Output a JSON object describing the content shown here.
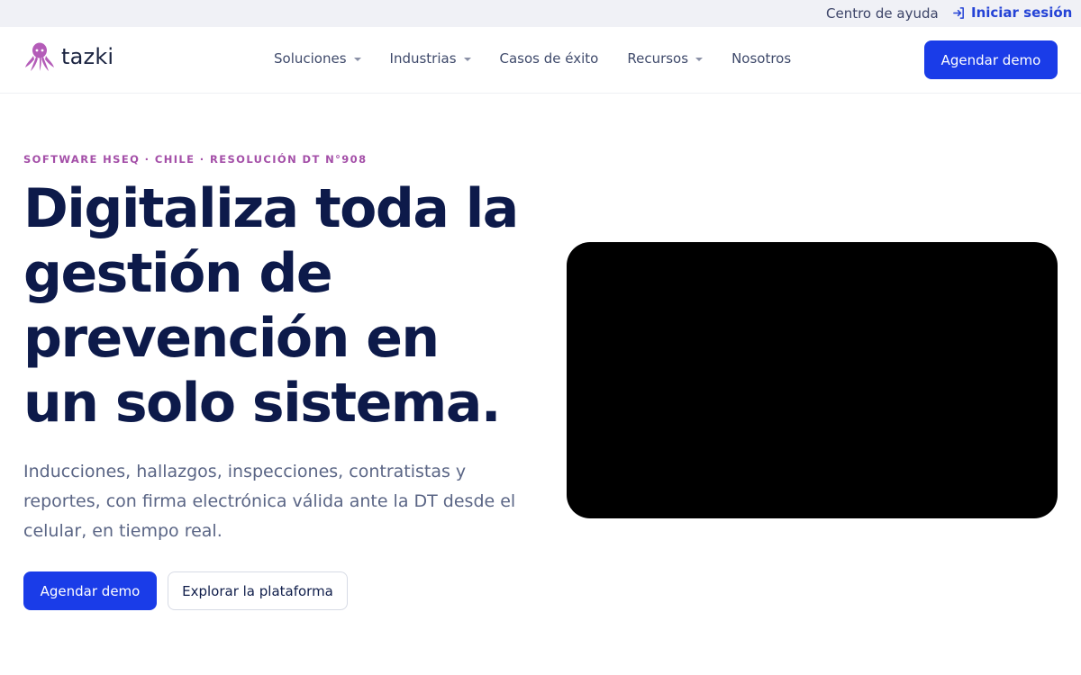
{
  "topbar": {
    "help_label": "Centro de ayuda",
    "login_label": "Iniciar sesión",
    "login_icon": "login-icon"
  },
  "nav": {
    "logo_text": "tazki",
    "logo_icon": "octopus-icon",
    "items": [
      {
        "label": "Soluciones",
        "has_dropdown": true
      },
      {
        "label": "Industrias",
        "has_dropdown": true
      },
      {
        "label": "Casos de éxito",
        "has_dropdown": false
      },
      {
        "label": "Recursos",
        "has_dropdown": true
      },
      {
        "label": "Nosotros",
        "has_dropdown": false
      }
    ],
    "cta_label": "Agendar demo"
  },
  "hero": {
    "eyebrow": "SOFTWARE HSEQ · CHILE · RESOLUCIÓN DT N°908",
    "headline": "Digitaliza toda la gestión de prevención en un solo sistema.",
    "lede": "Inducciones, hallazgos, inspecciones, contratistas y reportes, con firma electrónica válida ante la DT desde el celular, en tiempo real.",
    "primary_cta": "Agendar demo",
    "secondary_cta": "Explorar la plataforma"
  },
  "colors": {
    "brand_blue": "#1a3ce8",
    "headline_navy": "#0d1a4a",
    "eyebrow_purple": "#a44fa8",
    "topbar_bg": "#f0f1f6",
    "video_bg": "#000000"
  }
}
